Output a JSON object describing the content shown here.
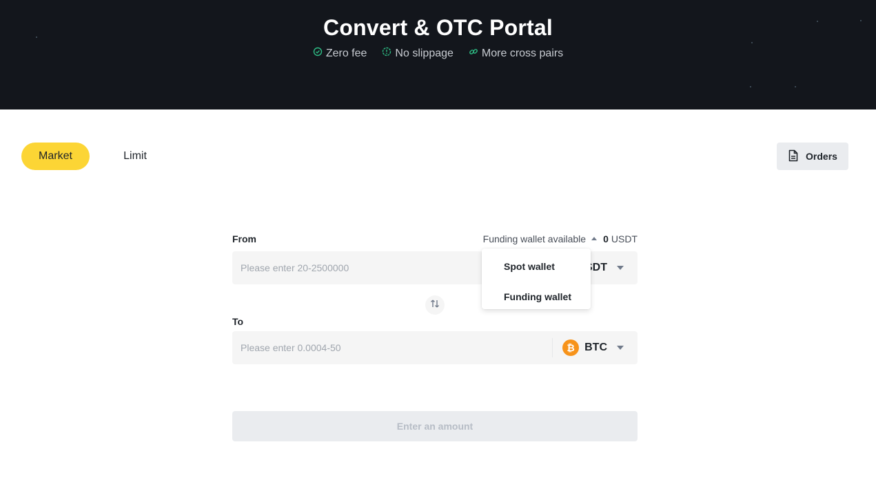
{
  "hero": {
    "title": "Convert & OTC Portal",
    "features": [
      {
        "label": "Zero fee",
        "icon": "check-circle-icon"
      },
      {
        "label": "No slippage",
        "icon": "shield-check-icon"
      },
      {
        "label": "More cross pairs",
        "icon": "link-icon"
      }
    ]
  },
  "tabs": {
    "market": "Market",
    "limit": "Limit",
    "active": "market"
  },
  "orders": {
    "label": "Orders",
    "icon": "document-icon"
  },
  "from": {
    "label": "From",
    "wallet_label": "Funding wallet available",
    "balance": "0",
    "balance_unit": "USDT",
    "placeholder": "Please enter 20-2500000",
    "value": "",
    "coin": "USDT",
    "coin_visible": "SDT"
  },
  "wallet_dropdown": {
    "items": [
      "Spot wallet",
      "Funding wallet"
    ]
  },
  "to": {
    "label": "To",
    "placeholder": "Please enter 0.0004-50",
    "value": "",
    "coin": "BTC",
    "coin_icon_glyph": "₿"
  },
  "submit": {
    "label": "Enter an amount"
  },
  "colors": {
    "accent": "#fcd535",
    "hero_bg": "#13161c",
    "feature_icon": "#2ebd85",
    "btc": "#f7931a"
  }
}
